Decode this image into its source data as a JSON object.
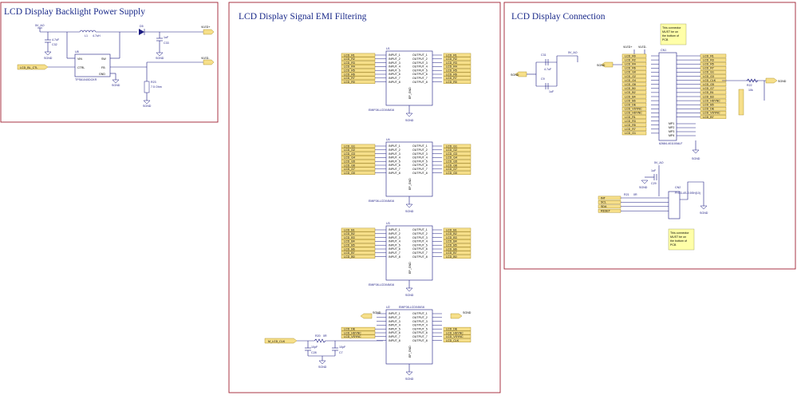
{
  "sections": {
    "backlight": {
      "title": "LCD Display Backlight Power Supply"
    },
    "emi": {
      "title": "LCD Display Signal EMI Filtering"
    },
    "connection": {
      "title": "LCD Display Connection"
    }
  },
  "nets": {
    "v_ao": "5V_AO",
    "vled_p": "VLED+",
    "vled_m": "VLED-",
    "sgnd": "SGND",
    "lcd_bl_ctl": "LCD_BL_CTL",
    "m_lcd_clk": "M_LCD_CLK"
  },
  "backlight": {
    "l1_ref": "L1",
    "l1_val": "4.7uH",
    "d_ref": "D5",
    "u_ref": "U8",
    "u_part": "TPS61040DCKR",
    "u_pins": [
      "VIN",
      "SW",
      "CTRL",
      "FB",
      "GND"
    ],
    "c_in": "C32",
    "c_in_val": "4.7uF",
    "c_out": "C33",
    "c_out_val": "1uF",
    "r_fb": "R23",
    "r_fb_val": "7.5 Ohm"
  },
  "emi": {
    "chip_part": "EMIF08-LCD04M16",
    "chips": [
      {
        "ref": "U1",
        "inputs": [
          "LCD_R1",
          "LCD_R2",
          "LCD_R3",
          "LCD_R4",
          "LCD_R5",
          "LCD_R6",
          "LCD_R7",
          "LCD_R0"
        ],
        "outputs": [
          "LCD_R1",
          "LCD_R2",
          "LCD_R3",
          "LCD_R4",
          "LCD_R5",
          "LCD_R6",
          "LCD_R7",
          "LCD_R0"
        ]
      },
      {
        "ref": "U4",
        "inputs": [
          "LCD_G1",
          "LCD_G2",
          "LCD_G3",
          "LCD_G4",
          "LCD_G5",
          "LCD_G6",
          "LCD_G7",
          "LCD_G0"
        ],
        "outputs": [
          "LCD_G1",
          "LCD_G2",
          "LCD_G3",
          "LCD_G4",
          "LCD_G5",
          "LCD_G6",
          "LCD_G7",
          "LCD_G0"
        ]
      },
      {
        "ref": "U3",
        "inputs": [
          "LCD_B1",
          "LCD_B2",
          "LCD_B3",
          "LCD_B4",
          "LCD_B5",
          "LCD_B6",
          "LCD_B7",
          "LCD_B0"
        ],
        "outputs": [
          "LCD_B1",
          "LCD_B2",
          "LCD_B3",
          "LCD_B4",
          "LCD_B5",
          "LCD_B6",
          "LCD_B7",
          "LCD_B0"
        ]
      },
      {
        "ref": "U2",
        "inputs": [
          "",
          "",
          "",
          "",
          "LCD_DE",
          "LCD_HSYNC",
          "LCD_VSYNC",
          ""
        ],
        "outputs": [
          "",
          "",
          "",
          "",
          "LCD_DE",
          "LCD_HSYNC",
          "LCD_VSYNC",
          "LCD_CLK"
        ]
      }
    ],
    "pin_in": [
      "INPUT_1",
      "INPUT_2",
      "INPUT_3",
      "INPUT_4",
      "INPUT_5",
      "INPUT_6",
      "INPUT_7",
      "INPUT_8"
    ],
    "pin_out": [
      "OUTPUT_1",
      "OUTPUT_2",
      "OUTPUT_3",
      "OUTPUT_4",
      "OUTPUT_5",
      "OUTPUT_6",
      "OUTPUT_7",
      "OUTPUT_8"
    ],
    "ep_gnd": "EP_GND",
    "clk_r": "R20",
    "clk_r_val": "0R",
    "clk_c1": "C28",
    "clk_c1_val": "10pF",
    "clk_c2": "C7",
    "clk_c2_val": "10pF"
  },
  "connection": {
    "c31": "C31",
    "c31_val": "4.7uF",
    "c9": "C9",
    "c9_val": "1uF",
    "cn_ref": "CN1",
    "cn_part": "62684-401100ALF",
    "left_pins": [
      "LCD_R0",
      "LCD_R2",
      "LCD_R4",
      "LCD_R6",
      "LCD_G0",
      "LCD_G2",
      "LCD_G4",
      "LCD_G6",
      "LCD_B0",
      "LCD_B2",
      "LCD_B4",
      "LCD_B6",
      "LCD_DE",
      "LCD_VSYNC",
      "LCD_HSYNC",
      "LCD_R1",
      "LCD_R3",
      "LCD_R5",
      "LCD_R7",
      "LCD_G1"
    ],
    "right_pins": [
      "LCD_R1",
      "LCD_R3",
      "LCD_R5",
      "LCD_R7",
      "LCD_G1",
      "LCD_G3",
      "LCD_CLK",
      "LCD_G5",
      "LCD_G7",
      "LCD_B1",
      "LCD_B3",
      "LCD_HSYNC",
      "LCD_B5",
      "LCD_DE",
      "LCD_VSYNC",
      "LCD_B7"
    ],
    "mp": [
      "MP1",
      "MP2",
      "MP3",
      "MP4"
    ],
    "r22": "R22",
    "r22_val": "10k",
    "note1": [
      "This connector",
      "MUST be on",
      "the bottom of",
      "PCB"
    ],
    "note2": [
      "This connector",
      "MUST be on",
      "the bottom of",
      "PCB"
    ],
    "cn2_ref": "CN2",
    "cn2_part": "FH33-4S-0.5SH(10)",
    "r21": "R21",
    "r21_val": "0R",
    "c29": "C29",
    "c29_val": "1uF",
    "touch_ports": [
      "INT",
      "SCL",
      "SDA",
      "RESET"
    ]
  }
}
